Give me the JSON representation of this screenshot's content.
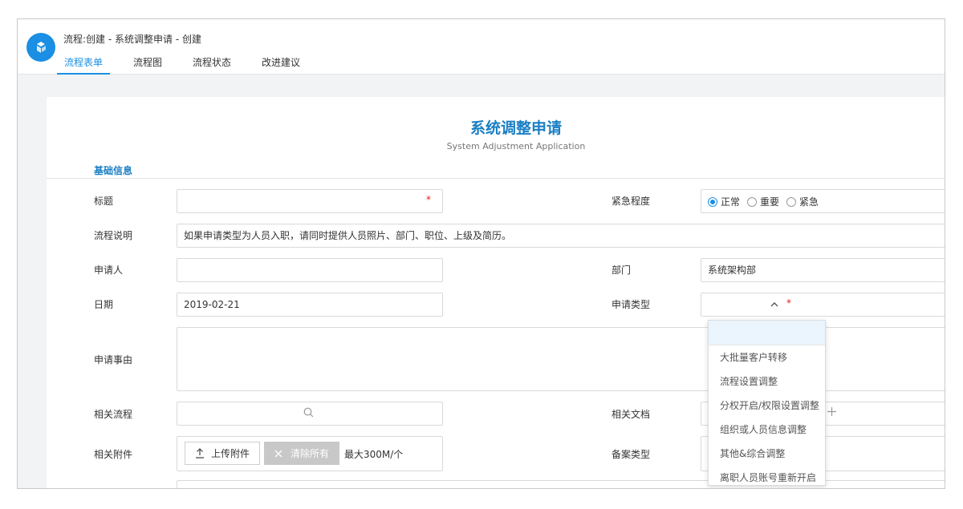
{
  "header": {
    "title": "流程:创建 - 系统调整申请 - 创建",
    "tabs": [
      {
        "label": "流程表单",
        "active": true
      },
      {
        "label": "流程图",
        "active": false
      },
      {
        "label": "流程状态",
        "active": false
      },
      {
        "label": "改进建议",
        "active": false
      }
    ]
  },
  "form": {
    "title": "系统调整申请",
    "subtitle": "System Adjustment Application",
    "section": "基础信息",
    "fields": {
      "title_label": "标题",
      "title_value": "",
      "urgency_label": "紧急程度",
      "urgency_options": [
        "正常",
        "重要",
        "紧急"
      ],
      "urgency_selected": "正常",
      "description_label": "流程说明",
      "description_value": "如果申请类型为人员入职，请同时提供人员照片、部门、职位、上级及简历。",
      "applicant_label": "申请人",
      "applicant_value": "",
      "department_label": "部门",
      "department_value": "系统架构部",
      "date_label": "日期",
      "date_value": "2019-02-21",
      "request_type_label": "申请类型",
      "reason_label": "申请事由",
      "related_flow_label": "相关流程",
      "related_doc_label": "相关文档",
      "attachment_label": "相关附件",
      "upload_button": "上传附件",
      "clear_button": "清除所有",
      "max_size_note": "最大300M/个",
      "record_type_label": "备案类型",
      "required_mark": "*"
    }
  },
  "dropdown": {
    "options": [
      "大批量客户转移",
      "流程设置调整",
      "分权开启/权限设置调整",
      "组织或人员信息调整",
      "其他&综合调整",
      "离职人员账号重新开启"
    ]
  },
  "colors": {
    "accent": "#1a8fe3",
    "title": "#1a7fc4",
    "required": "#e02020"
  }
}
